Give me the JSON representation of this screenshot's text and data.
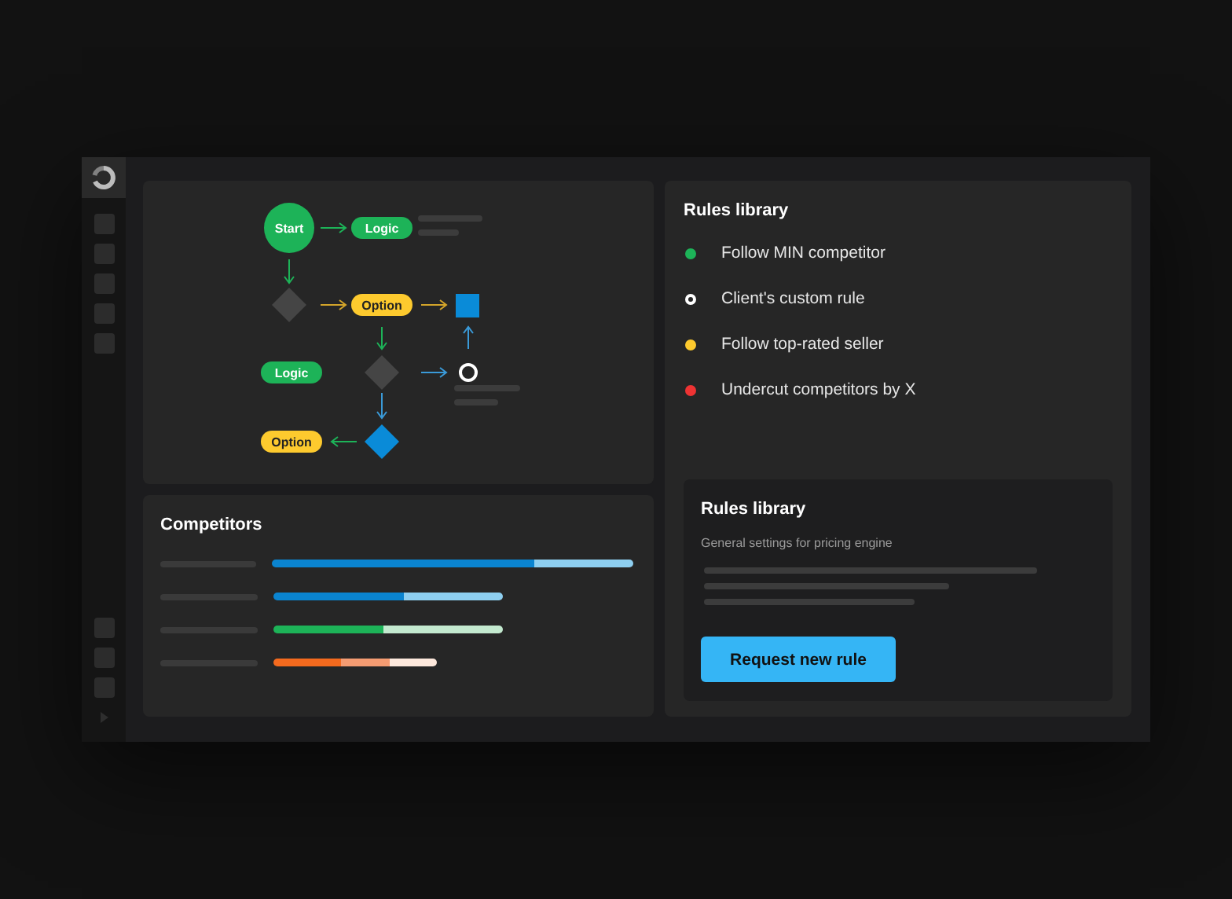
{
  "flowchart": {
    "nodes": [
      {
        "kind": "circle",
        "label": "Start",
        "color": "#1db358"
      },
      {
        "kind": "pill",
        "label": "Logic",
        "color": "#1db358"
      },
      {
        "kind": "diamond",
        "color": "#454545"
      },
      {
        "kind": "pill",
        "label": "Option",
        "color": "#fdca2e"
      },
      {
        "kind": "square",
        "color": "#0a8bd8"
      },
      {
        "kind": "pill",
        "label": "Logic",
        "color": "#1db358"
      },
      {
        "kind": "diamond",
        "color": "#454545"
      },
      {
        "kind": "ring",
        "color": "#ffffff"
      },
      {
        "kind": "diamond",
        "color": "#0a8bd8"
      },
      {
        "kind": "pill",
        "label": "Option",
        "color": "#fdca2e"
      }
    ]
  },
  "competitors": {
    "title": "Competitors",
    "rows": [
      {
        "segments": [
          {
            "color": "#0a84d0"
          },
          {
            "color": "#8ecff0"
          }
        ]
      },
      {
        "segments": [
          {
            "color": "#0a84d0"
          },
          {
            "color": "#8ecff0"
          }
        ]
      },
      {
        "segments": [
          {
            "color": "#1db358"
          },
          {
            "color": "#c3e9cf"
          }
        ]
      },
      {
        "segments": [
          {
            "color": "#f46a1e"
          },
          {
            "color": "#f59c72"
          },
          {
            "color": "#fde8dc"
          }
        ]
      }
    ]
  },
  "rules_library": {
    "title": "Rules library",
    "rules": [
      {
        "kind": "dot",
        "label": "Follow MIN competitor",
        "color": "#1db358"
      },
      {
        "kind": "ring",
        "label": "Client's custom rule",
        "color": "#ffffff"
      },
      {
        "kind": "dot",
        "label": "Follow top-rated seller",
        "color": "#fdca2e"
      },
      {
        "kind": "dot",
        "label": "Undercut competitors by X",
        "color": "#ee3333"
      }
    ]
  },
  "rules_card": {
    "title": "Rules library",
    "subtitle": "General settings for pricing engine",
    "button": "Request new rule"
  }
}
